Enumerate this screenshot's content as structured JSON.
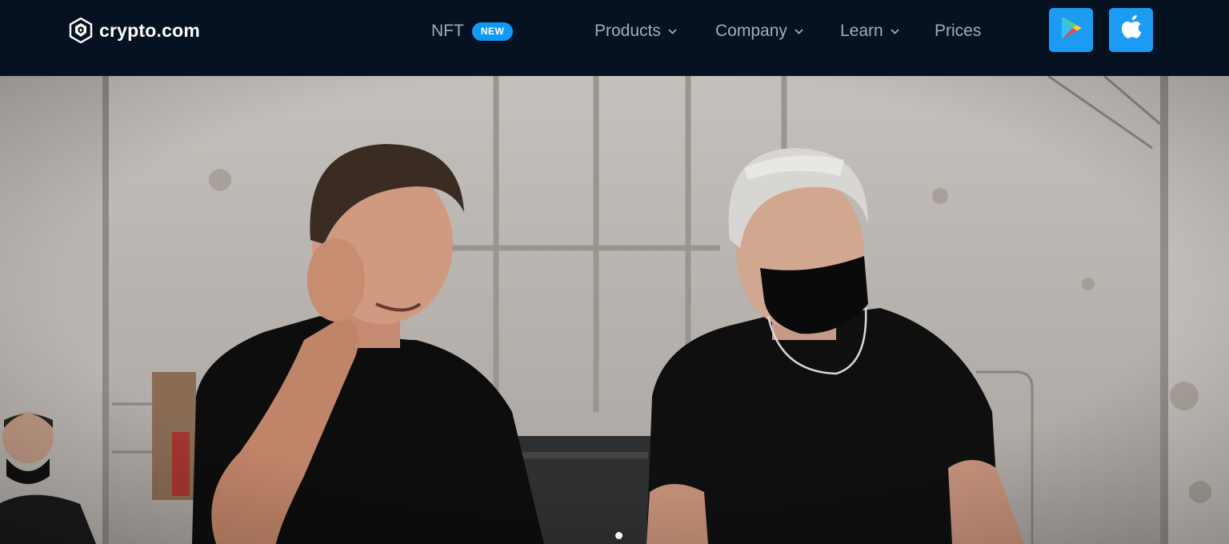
{
  "brand": {
    "name": "crypto.com",
    "logo_icon": "crypto-lion-shield-icon"
  },
  "nav": {
    "nft": {
      "label": "NFT",
      "badge": "NEW"
    },
    "products": {
      "label": "Products"
    },
    "company": {
      "label": "Company"
    },
    "learn": {
      "label": "Learn"
    },
    "prices": {
      "label": "Prices"
    }
  },
  "stores": [
    {
      "icon": "google-play-icon"
    },
    {
      "icon": "apple-icon"
    }
  ],
  "hero": {
    "image": "two men in black t-shirts walking on a warehouse film set",
    "carousel_active": 1
  },
  "colors": {
    "header_bg": "#061121",
    "nav_text": "#a3acba",
    "badge_bg": "#1199fa",
    "store_bg": "#1b9cf2"
  }
}
